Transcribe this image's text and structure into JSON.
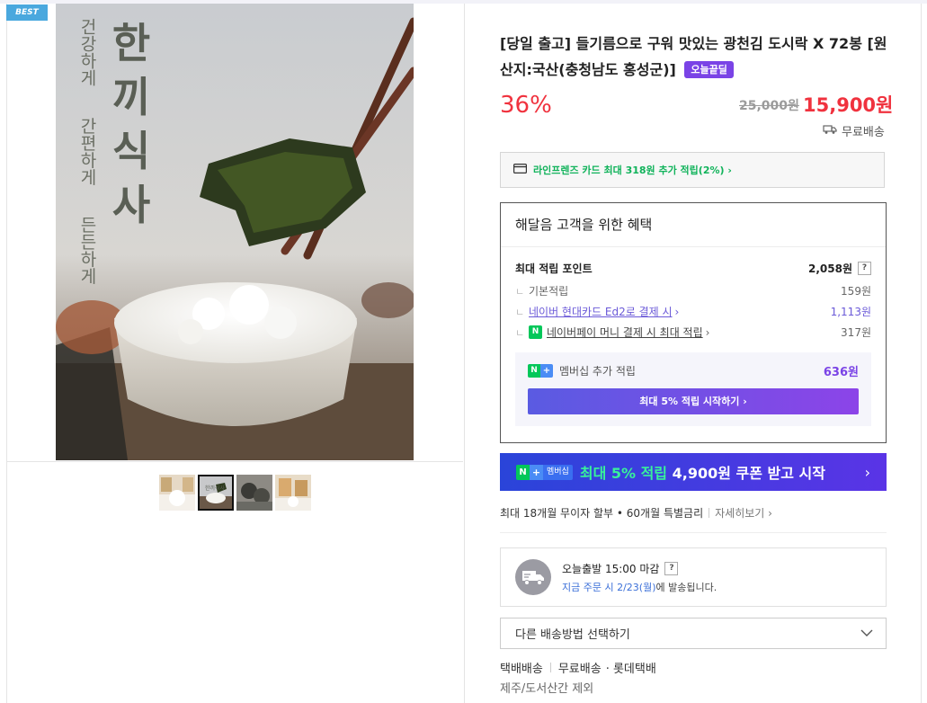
{
  "badge_best": "BEST",
  "product_image": {
    "vertical_title": [
      "한",
      "끼",
      "식",
      "사"
    ],
    "vertical_sub": [
      "건강하게",
      "간편하게",
      "든든하게"
    ]
  },
  "thumbs": [
    {
      "name": "thumb-1",
      "active": false
    },
    {
      "name": "thumb-2",
      "active": true,
      "text": "한끼식사"
    },
    {
      "name": "thumb-3",
      "active": false
    },
    {
      "name": "thumb-4",
      "active": false
    }
  ],
  "product": {
    "title": "[당일 출고] 들기름으로 구워 맛있는 광천김 도시락 X 72봉 [원산지:국산(충청남도 홍성군)]",
    "badge": "오늘끝딜",
    "discount": "36%",
    "original_price": "25,000원",
    "price": "15,900원",
    "shipping": "무료배송"
  },
  "card_promo": "라인프렌즈 카드 최대 318원 추가 적립(2%) ›",
  "benefit": {
    "title": "해달음 고객을 위한 혜택",
    "max_points_label": "최대 적립 포인트",
    "max_points_value": "2,058원",
    "qmark": "?",
    "sub_prefix": "ㄴ",
    "basic_label": "기본적립",
    "basic_value": "159원",
    "card_label": "네이버 현대카드 Ed2로 결제 시",
    "card_arrow": "›",
    "card_value": "1,113원",
    "npay_icon": "N",
    "npay_label": "네이버페이 머니 결제 시 최대 적립",
    "npay_arrow": "›",
    "npay_value": "317원",
    "member_tag_n": "N",
    "member_tag_plus": "+",
    "member_label": "멤버십 추가 적립",
    "member_value": "636원",
    "member_button": "최대 5% 적립 시작하기 ›"
  },
  "coupon": {
    "tag_n": "N",
    "tag_plus": "+",
    "tag_member": "멤버십",
    "highlight": "최대 5% 적립",
    "text": "4,900원 쿠폰 받고 시작",
    "arrow": "›"
  },
  "installment": {
    "text": "최대 18개월 무이자 할부 • 60개월 특별금리",
    "more": "자세히보기 ›"
  },
  "delivery": {
    "line1": "오늘출발 15:00 마감",
    "qmark": "?",
    "line2_blue": "지금 주문 시 2/23(월)",
    "line2_rest": "에 발송됩니다."
  },
  "ship_select": {
    "label": "다른 배송방법 선택하기"
  },
  "ship_info": {
    "method": "택배배송",
    "fee": "무료배송",
    "carrier": "· 롯데택배",
    "exclude": "제주/도서산간 제외"
  },
  "colors": {
    "accent_red": "#f0323e",
    "naver_green": "#03c75a",
    "purple": "#7a43e6",
    "coupon_blue": "#2a44d9"
  }
}
